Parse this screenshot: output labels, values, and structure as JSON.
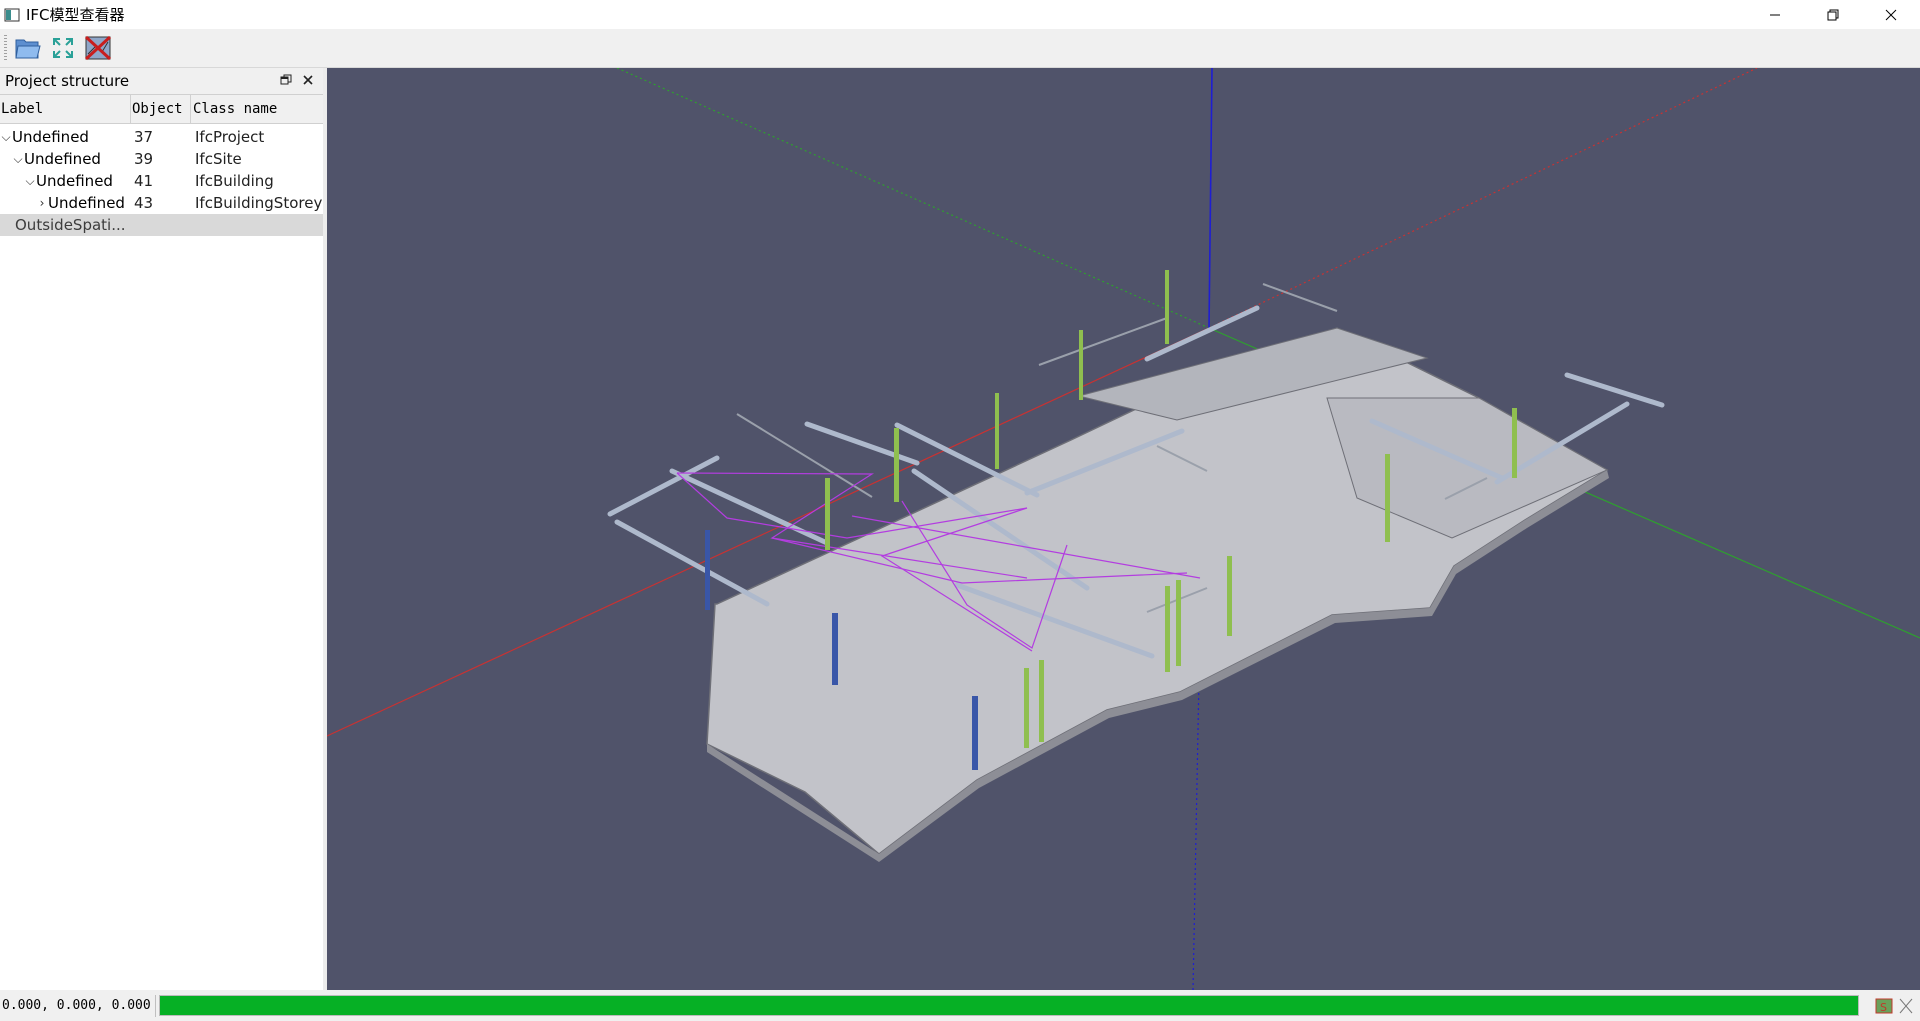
{
  "window": {
    "title": "IFC模型查看器",
    "controls": {
      "minimize": "minimize-icon",
      "maximize": "restore-icon",
      "close": "close-icon"
    }
  },
  "toolbar": {
    "buttons": [
      {
        "name": "open-file-button",
        "icon": "folder-open-icon"
      },
      {
        "name": "fit-view-button",
        "icon": "expand-arrows-icon"
      },
      {
        "name": "clear-model-button",
        "icon": "clear-model-icon"
      }
    ]
  },
  "dock": {
    "title": "Project structure",
    "columns": {
      "label": "Label",
      "object": "Object",
      "class_name": "Class name"
    },
    "rows": [
      {
        "label": "Undefined",
        "object": "37",
        "class_name": "IfcProject",
        "expanded": true,
        "depth": 0
      },
      {
        "label": "Undefined",
        "object": "39",
        "class_name": "IfcSite",
        "expanded": true,
        "depth": 1
      },
      {
        "label": "Undefined",
        "object": "41",
        "class_name": "IfcBuilding",
        "expanded": true,
        "depth": 2
      },
      {
        "label": "Undefined",
        "object": "43",
        "class_name": "IfcBuildingStorey",
        "expanded": false,
        "depth": 3
      },
      {
        "label": "OutsideSpati...",
        "object": "",
        "class_name": "",
        "selected": true,
        "depth": 1
      }
    ]
  },
  "viewport": {
    "background": "#50536a",
    "axis_colors": {
      "x": "#c83232",
      "y": "#2ea02e",
      "z": "#1e1ed2"
    }
  },
  "status": {
    "coordinates": "0.000,  0.000,  0.000",
    "progress": 1.0,
    "progress_color": "#06b025"
  }
}
